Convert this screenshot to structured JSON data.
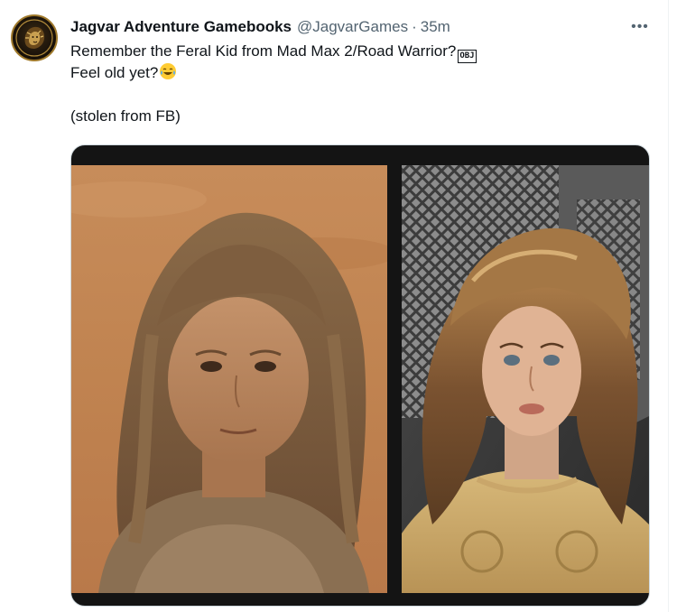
{
  "author": {
    "display_name": "Jagvar Adventure Gamebooks",
    "handle": "@JagvarGames",
    "separator": "·",
    "timestamp": "35m"
  },
  "more_label": "•••",
  "tweet": {
    "line1": "Remember the Feral Kid from Mad Max 2/Road Warrior?",
    "obj_glyph": "OBJ",
    "line2": "Feel old yet?",
    "line3": "(stolen from FB)"
  },
  "icons": {
    "avatar": "lion-logo-icon",
    "more": "more-options-icon",
    "emoji": "face-with-tears-of-joy-emoji"
  },
  "colors": {
    "text": "#0f1419",
    "secondary": "#536471",
    "border": "#eff3f4"
  }
}
